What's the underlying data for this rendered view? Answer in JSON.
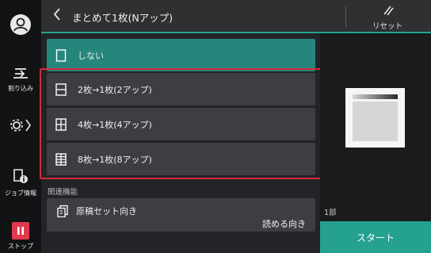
{
  "header": {
    "back_icon": "chevron-left-icon",
    "title": "まとめて1枚(Nアップ)",
    "reset_label": "リセット"
  },
  "sidebar": {
    "items": [
      {
        "name": "avatar",
        "label": ""
      },
      {
        "name": "interrupt",
        "label": "割り込み"
      },
      {
        "name": "settings",
        "label": ""
      },
      {
        "name": "job-info",
        "label": "ジョブ情報"
      },
      {
        "name": "stop",
        "label": "ストップ"
      }
    ]
  },
  "options": [
    {
      "label": "しない",
      "selected": true,
      "icon": "single-page-icon"
    },
    {
      "label": "2枚→1枚(2アップ)",
      "selected": false,
      "icon": "two-up-icon"
    },
    {
      "label": "4枚→1枚(4アップ)",
      "selected": false,
      "icon": "four-up-icon"
    },
    {
      "label": "8枚→1枚(8アップ)",
      "selected": false,
      "icon": "eight-up-icon"
    }
  ],
  "related": {
    "heading": "関連機能",
    "orientation_title": "原稿セット向き",
    "orientation_value": "読める向き"
  },
  "right": {
    "copies": "1部",
    "start_label": "スタート"
  },
  "colors": {
    "accent": "#25a28f",
    "selected": "#25877b",
    "highlight_border": "#d8283c",
    "stop": "#e03a4e"
  }
}
